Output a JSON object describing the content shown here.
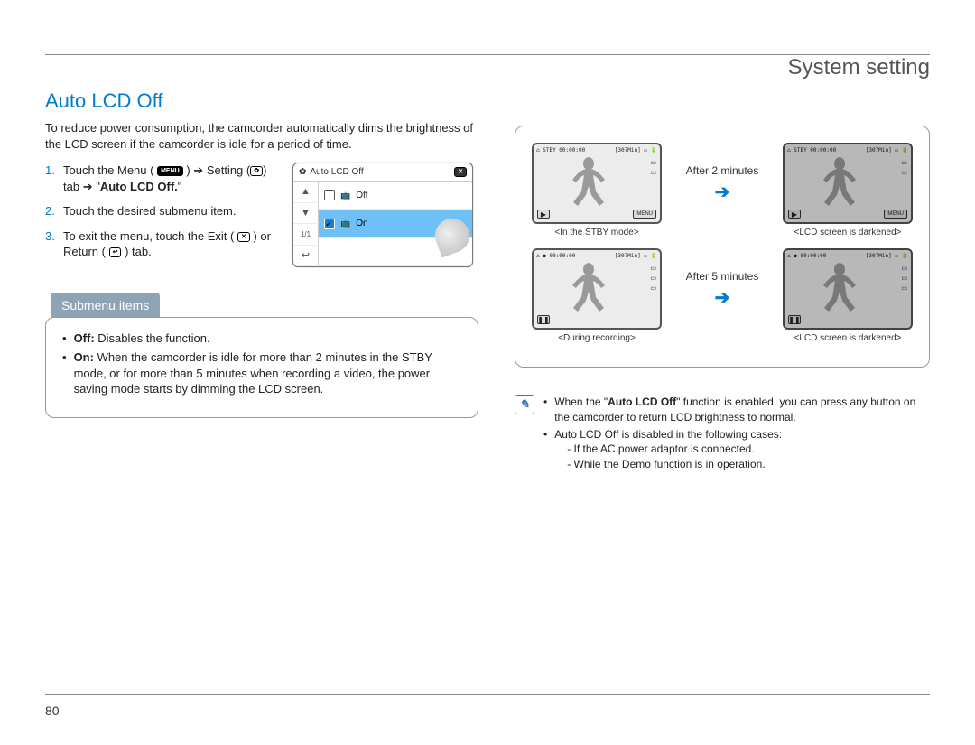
{
  "header": {
    "title": "System setting"
  },
  "feature": {
    "title": "Auto LCD Off",
    "intro": "To reduce power consumption, the camcorder automatically dims the brightness of the LCD screen if the camcorder is idle for a period of time."
  },
  "steps": {
    "s1a": "Touch the Menu (",
    "s1b": ") ",
    "s1c": " Setting (",
    "s1d": ") tab ",
    "s1e": " \"",
    "s1f": "Auto LCD Off.",
    "s1g": "\"",
    "s2": "Touch the desired submenu item.",
    "s3a": "To exit the menu, touch the Exit (",
    "s3b": ") or Return (",
    "s3c": ") tab."
  },
  "icons": {
    "menu": "MENU",
    "gear": "✿",
    "exit": "✕",
    "return": "↩",
    "arrow": "➔",
    "play": "▶",
    "rec": "●",
    "pause": "❚❚"
  },
  "menu_panel": {
    "title": "Auto LCD Off",
    "row_off": "Off",
    "row_on": "On"
  },
  "submenu": {
    "label": "Submenu items",
    "off_bold": "Off:",
    "off_text": " Disables the function.",
    "on_bold": "On:",
    "on_text": " When the camcorder is idle for more than 2 minutes in the STBY mode, or for more than 5 minutes when recording a video, the power saving mode starts by dimming the LCD screen."
  },
  "diagram": {
    "after2": "After 2 minutes",
    "after5": "After 5 minutes",
    "cap_stby": "<In the STBY mode>",
    "cap_rec": "<During recording>",
    "cap_dark": "<LCD screen is darkened>",
    "lcd": {
      "stby_time": "STBY 00:00:00",
      "rec_time": "00:00:00",
      "remain": "[307Min]",
      "menu": "MENU"
    }
  },
  "notes": {
    "n1a": "When the \"",
    "n1b": "Auto LCD Off",
    "n1c": "\" function is enabled, you can press any button on the camcorder to return LCD brightness to normal.",
    "n2": "Auto LCD Off is disabled in the following cases:",
    "n2a": "If the AC power adaptor is connected.",
    "n2b": "While the Demo function is in operation."
  },
  "page": "80"
}
